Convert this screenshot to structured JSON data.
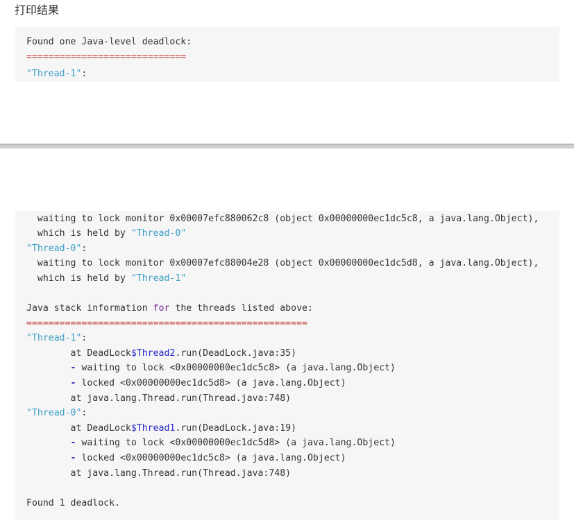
{
  "heading": "打印结果",
  "block1": {
    "l1": "Found one Java-level deadlock:",
    "l2": "=============================",
    "l3_str": "\"Thread-1\"",
    "l3_rest": ":"
  },
  "block2": {
    "l1": "  waiting to lock monitor 0x00007efc880062c8 (object 0x00000000ec1dc5c8, a java.lang.Object),",
    "l2_pre": "  which is held by ",
    "l2_str": "\"Thread-0\"",
    "l3_str": "\"Thread-0\"",
    "l3_rest": ":",
    "l4": "  waiting to lock monitor 0x00007efc88004e28 (object 0x00000000ec1dc5d8, a java.lang.Object),",
    "l5_pre": "  which is held by ",
    "l5_str": "\"Thread-1\"",
    "l6_pre": "Java stack information ",
    "l6_kw": "for",
    "l6_post": " the threads listed above:",
    "l7": "===================================================",
    "l8_str": "\"Thread-1\"",
    "l8_rest": ":",
    "l9_pre": "        at DeadLock",
    "l9_var": "$Thread2",
    "l9_post": ".run(DeadLock.java:35)",
    "l10_dash": "-",
    "l10_rest": " waiting to lock <0x00000000ec1dc5c8> (a java.lang.Object)",
    "l11_dash": "-",
    "l11_rest": " locked <0x00000000ec1dc5d8> (a java.lang.Object)",
    "l12": "        at java.lang.Thread.run(Thread.java:748)",
    "l13_str": "\"Thread-0\"",
    "l13_rest": ":",
    "l14_pre": "        at DeadLock",
    "l14_var": "$Thread1",
    "l14_post": ".run(DeadLock.java:19)",
    "l15_dash": "-",
    "l15_rest": " waiting to lock <0x00000000ec1dc5d8> (a java.lang.Object)",
    "l16_dash": "-",
    "l16_rest": " locked <0x00000000ec1dc5c8> (a java.lang.Object)",
    "l17": "        at java.lang.Thread.run(Thread.java:748)",
    "l18": "Found 1 deadlock."
  },
  "colors": {
    "string": "#3b9fc4",
    "keyword": "#7a1e99",
    "variable": "#2828c8",
    "separator": "#c43b3b",
    "code_bg": "#f6f6f6"
  }
}
